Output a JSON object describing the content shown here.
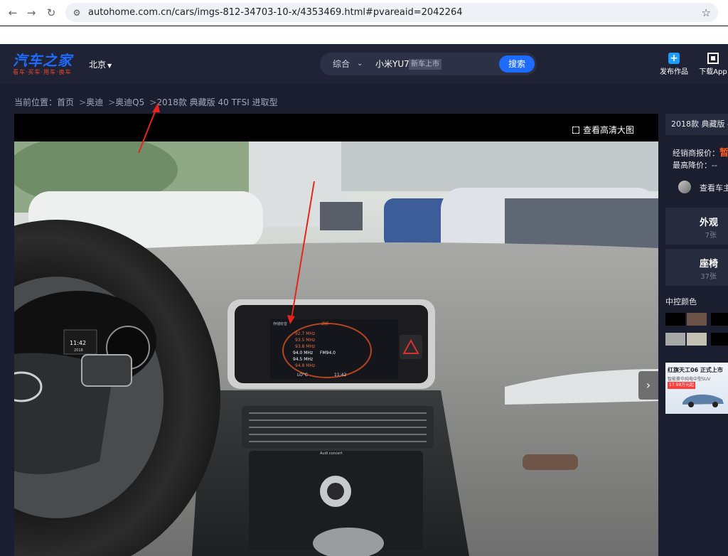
{
  "browser": {
    "url": "autohome.com.cn/cars/imgs-812-34703-10-x/4353469.html#pvareaid=2042264"
  },
  "header": {
    "logo_main": "汽车之家",
    "logo_sub": "看车·买车·用车·换车",
    "city": "北京",
    "search_category": "综合",
    "search_query": "小米YU7",
    "search_tag": "新车上市",
    "search_button": "搜索",
    "publish_label": "发布作品",
    "download_label": "下载App"
  },
  "breadcrumb": {
    "prefix": "当前位置：",
    "items": [
      "首页",
      "奥迪",
      "奥迪Q5",
      "2018款 典藏版 40 TFSI 进取型"
    ]
  },
  "viewer": {
    "hd_label": "查看高清大图",
    "screen_rows": [
      "92.7 MHz",
      "93.5 MHz",
      "93.8 MHz",
      "94.0 MHz",
      "94.5 MHz",
      "94.8 MHz"
    ],
    "screen_label_fm": "FM94.0",
    "screen_top_left": "存储收音",
    "screen_top_right": "调频",
    "screen_temp": "LO°C",
    "screen_time": "11:42",
    "cluster_time": "11:42",
    "cluster_year": "2018",
    "radio_brand": "Audi concert"
  },
  "sidebar": {
    "car_title": "2018款 典藏版 4",
    "dealer_price_label": "经销商报价：",
    "dealer_price_value": "暂",
    "max_drop_label": "最高降价：--",
    "owner_label": "查看车主",
    "categories": [
      {
        "name": "外观",
        "count": "7张"
      },
      {
        "name": "座椅",
        "count": "37张"
      }
    ],
    "color_title": "中控颜色",
    "swatches": [
      "#000000",
      "#6b5447",
      "#000000",
      "#a7a9a9",
      "#c3c1b4",
      "#000000"
    ],
    "ad_title": "红旗天工06 正式上市",
    "ad_sub": "智能豪华纯电中型SUV",
    "ad_price": "17.98万元起"
  },
  "colors": {
    "accent": "#1e6bff",
    "header_bg": "#1f2335",
    "page_bg": "#1b1e2e",
    "warn": "#ff5a1e"
  }
}
